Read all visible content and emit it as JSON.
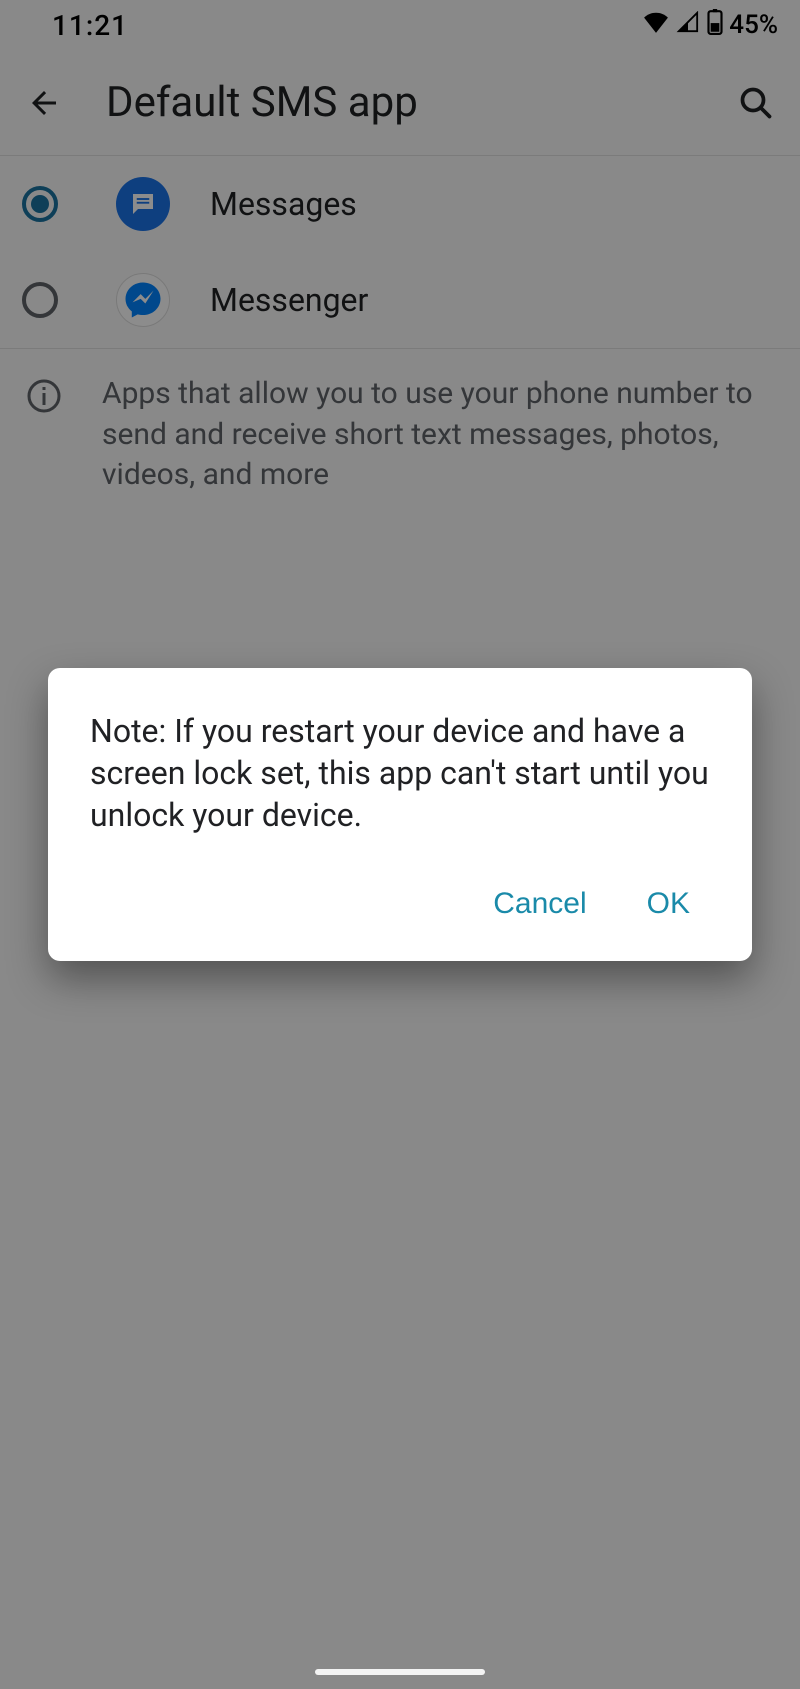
{
  "status": {
    "time": "11:21",
    "battery": "45%"
  },
  "toolbar": {
    "title": "Default SMS app"
  },
  "apps": [
    {
      "label": "Messages",
      "selected": true,
      "icon": "messages"
    },
    {
      "label": "Messenger",
      "selected": false,
      "icon": "messenger"
    }
  ],
  "info": {
    "text": "Apps that allow you to use your phone number to send and receive short text messages, photos, videos, and more"
  },
  "dialog": {
    "message": "Note: If you restart your device and have a screen lock set, this app can't start until you unlock your device.",
    "cancel": "Cancel",
    "ok": "OK"
  }
}
